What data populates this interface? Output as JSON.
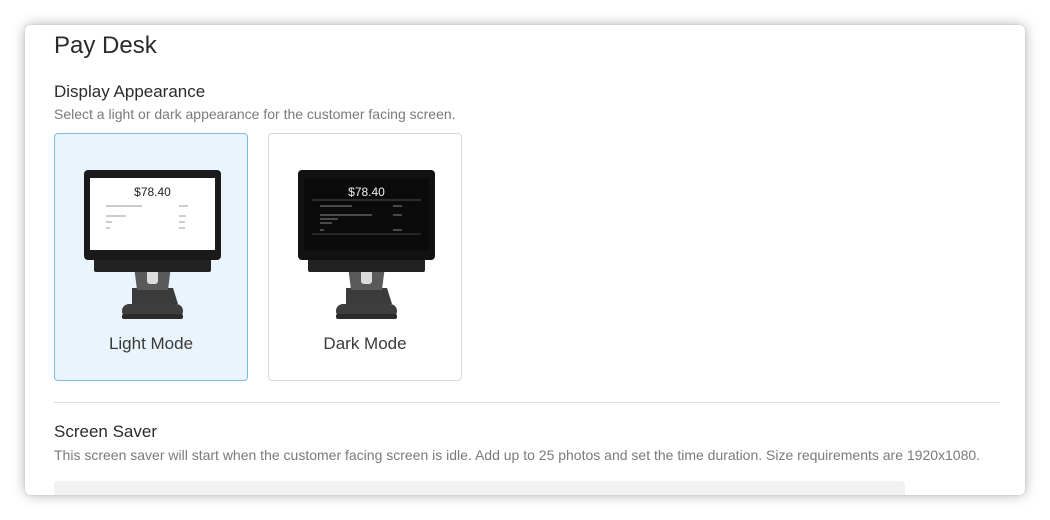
{
  "page": {
    "title": "Pay Desk"
  },
  "display_appearance": {
    "title": "Display Appearance",
    "description": "Select a light or dark appearance for the customer facing screen.",
    "options": [
      {
        "label": "Light Mode",
        "price": "$78.40",
        "selected": true
      },
      {
        "label": "Dark Mode",
        "price": "$78.40",
        "selected": false
      }
    ]
  },
  "screen_saver": {
    "title": "Screen Saver",
    "description": "This screen saver will start when the customer facing screen is idle. Add up to 25 photos and set the time duration. Size requirements are 1920x1080."
  },
  "colors": {
    "selected_bg": "#e9f4fc",
    "selected_border": "#7bbbe6"
  }
}
